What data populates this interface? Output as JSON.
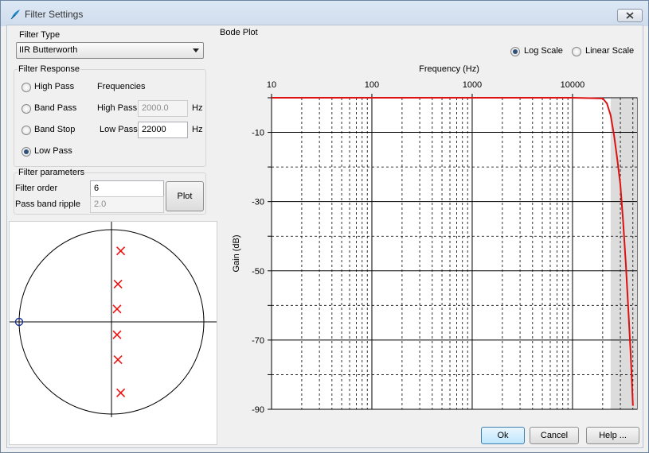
{
  "window": {
    "title": "Filter Settings",
    "app_icon": "feather-icon",
    "close_icon": "close-icon"
  },
  "filter_type": {
    "label": "Filter Type",
    "selected": "IIR Butterworth",
    "dropdown_icon": "chevron-down-icon"
  },
  "filter_response": {
    "label": "Filter Response",
    "options": [
      {
        "label": "High Pass",
        "selected": false
      },
      {
        "label": "Band Pass",
        "selected": false
      },
      {
        "label": "Band Stop",
        "selected": false
      },
      {
        "label": "Low Pass",
        "selected": true
      }
    ],
    "frequencies_label": "Frequencies",
    "high_pass": {
      "label": "High Pass",
      "value": "2000.0",
      "unit": "Hz",
      "enabled": false
    },
    "low_pass": {
      "label": "Low Pass",
      "value": "22000",
      "unit": "Hz",
      "enabled": true
    }
  },
  "filter_parameters": {
    "label": "Filter parameters",
    "order_label": "Filter order",
    "order_value": "6",
    "ripple_label": "Pass band ripple",
    "ripple_value": "2.0",
    "plot_button": "Plot"
  },
  "pole_zero": {
    "poles": [
      {
        "re": 0.1,
        "im": 0.77
      },
      {
        "re": 0.07,
        "im": 0.41
      },
      {
        "re": 0.06,
        "im": 0.14
      },
      {
        "re": 0.06,
        "im": -0.14
      },
      {
        "re": 0.07,
        "im": -0.41
      },
      {
        "re": 0.1,
        "im": -0.77
      }
    ],
    "zeros": [
      {
        "re": -1.0,
        "im": 0.0
      }
    ],
    "pole_color": "#ee1111",
    "zero_color": "#1a2f9c"
  },
  "bode": {
    "label": "Bode Plot",
    "scale_options": [
      {
        "label": "Log Scale",
        "selected": true
      },
      {
        "label": "Linear Scale",
        "selected": false
      }
    ],
    "curve_color": "#dd1111"
  },
  "chart_data": {
    "type": "line",
    "title": "",
    "xlabel": "Frequency (Hz)",
    "ylabel": "Gain (dB)",
    "x_scale": "log",
    "xlim": [
      10,
      44000
    ],
    "ylim": [
      -90,
      0
    ],
    "x_ticks": [
      "10",
      "100",
      "1000",
      "10000"
    ],
    "y_ticks": [
      "-10",
      "-30",
      "-50",
      "-70",
      "-90"
    ],
    "grid": true,
    "series": [
      {
        "x": [
          10,
          100,
          1000,
          10000,
          20000,
          22000,
          24000,
          26000,
          28000,
          30000,
          32000,
          34000,
          36000,
          38000,
          40000
        ],
        "y": [
          0,
          0,
          0,
          0,
          -0.2,
          -1.6,
          -5,
          -11,
          -18,
          -25,
          -36,
          -48,
          -61,
          -74,
          -89
        ]
      }
    ]
  },
  "footer": {
    "ok": "Ok",
    "cancel": "Cancel",
    "help": "Help ..."
  }
}
